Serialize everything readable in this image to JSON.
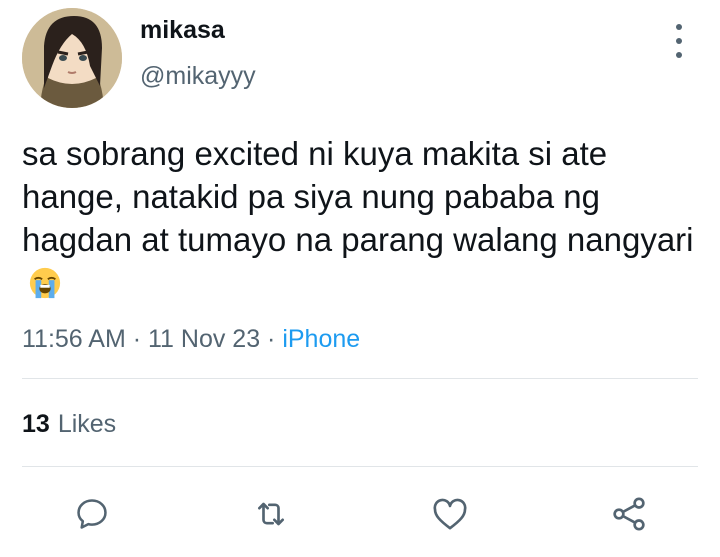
{
  "user": {
    "display_name": "mikasa",
    "handle": "@mikayyy",
    "avatar_icon": "anime-character-avatar"
  },
  "tweet": {
    "text": "sa sobrang excited ni kuya makita si ate hange, natakid pa siya nung pababa ng hagdan at tumayo na parang walang nangyari",
    "emoji": "😭",
    "time": "11:56 AM",
    "date": "11 Nov 23",
    "separator": " · ",
    "source": "iPhone"
  },
  "stats": {
    "likes_count": "13",
    "likes_label": "Likes"
  },
  "actions": {
    "icons": [
      "reply-icon",
      "retweet-icon",
      "like-icon",
      "share-icon"
    ]
  },
  "colors": {
    "text_primary": "#0f1419",
    "text_secondary": "#536471",
    "link": "#1d9bf0",
    "divider": "#e1e5e8"
  }
}
